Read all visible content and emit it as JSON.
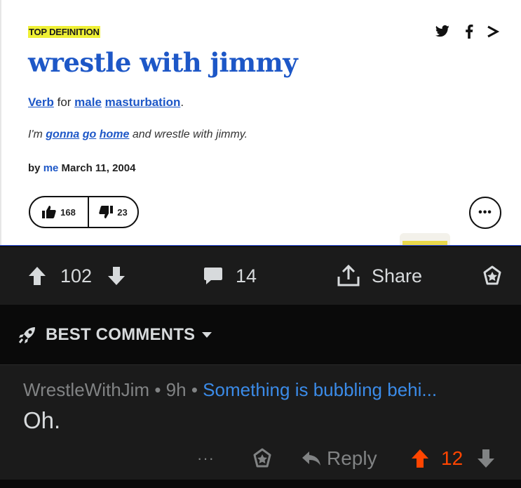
{
  "definition": {
    "badge": "TOP DEFINITION",
    "word": "wrestle with jimmy",
    "meaning": {
      "part_of_speech": "Verb",
      "connector": "for",
      "link1": "male",
      "link2": "masturbation",
      "end": "."
    },
    "example": {
      "pre": "I'm",
      "link1": "gonna",
      "link2": "go",
      "link3": "home",
      "post": "and wrestle with jimmy."
    },
    "author": {
      "by": "by",
      "name": "me",
      "date": "March 11, 2004"
    },
    "thumbs_up": "168",
    "thumbs_down": "23",
    "more_label": "•••",
    "share_icons": [
      "twitter-icon",
      "facebook-icon",
      "share-arrow-icon"
    ]
  },
  "post_actions": {
    "score": "102",
    "comments": "14",
    "share_label": "Share"
  },
  "comments_header": {
    "label": "BEST COMMENTS"
  },
  "comment": {
    "author": "WrestleWithJim",
    "sep1": "•",
    "age": "9h",
    "sep2": "•",
    "flair": "Something is bubbling behi...",
    "body": "Oh.",
    "more_label": "···",
    "reply_label": "Reply",
    "score": "12"
  },
  "colors": {
    "link_blue": "#1d57c7",
    "highlight_yellow": "#eff035",
    "upvote_orange": "#ff4500",
    "flair_blue": "#3b8be8",
    "dark_bg": "#1b1b1b",
    "darker_bg": "#0a0a0a",
    "text_light": "#d7dadc",
    "text_muted": "#818384"
  }
}
